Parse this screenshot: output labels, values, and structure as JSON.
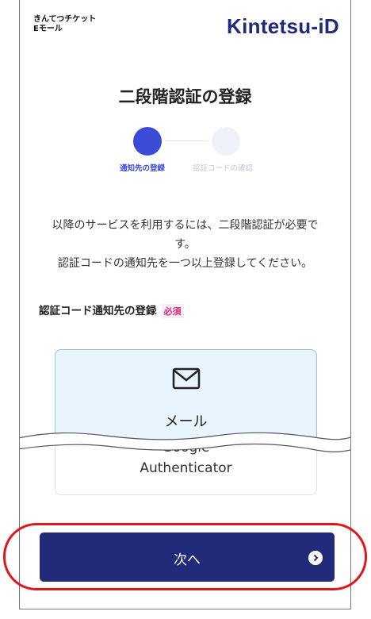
{
  "header": {
    "brand_line1": "きんてつチケット",
    "brand_line2": "Eモール",
    "logo_main": "Kintetsu-",
    "logo_id": "iD"
  },
  "page": {
    "title": "二段階認証の登録"
  },
  "steps": [
    {
      "label": "通知先の登録",
      "state": "active"
    },
    {
      "label": "認証コードの確認",
      "state": "inactive"
    }
  ],
  "description": {
    "line1": "以降のサービスを利用するには、二段階認証が必要で",
    "line2": "す。",
    "line3": "認証コードの通知先を一つ以上登録してください。"
  },
  "section": {
    "label": "認証コード通知先の登録",
    "required_badge": "必須"
  },
  "options": [
    {
      "label": "メール",
      "icon": "mail-icon",
      "selected": true
    },
    {
      "label_line1": "Google",
      "label_line2": "Authenticator",
      "selected": false
    }
  ],
  "next_button": {
    "label": "次へ",
    "icon": "chevron-right-circle-icon"
  },
  "colors": {
    "brand_navy": "#222a7a",
    "accent_blue": "#3b4bd8",
    "required_pink": "#d4287a",
    "highlight_red": "#e0161b"
  }
}
